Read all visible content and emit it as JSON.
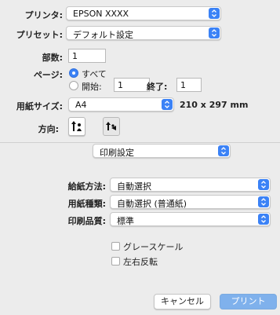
{
  "printer": {
    "label": "プリンタ:",
    "value": "EPSON XXXX"
  },
  "preset": {
    "label": "プリセット:",
    "value": "デフォルト設定"
  },
  "copies": {
    "label": "部数:",
    "value": "1"
  },
  "pages": {
    "label": "ページ:",
    "all_label": "すべて",
    "from_label": "開始:",
    "from_value": "1",
    "to_label": "終了:",
    "to_value": "1"
  },
  "paper_size": {
    "label": "用紙サイズ:",
    "value": "A4",
    "dimensions": "210 x 297 mm"
  },
  "orientation": {
    "label": "方向:"
  },
  "section": {
    "value": "印刷設定"
  },
  "paper_source": {
    "label": "給紙方法:",
    "value": "自動選択"
  },
  "media_type": {
    "label": "用紙種類:",
    "value": "自動選択 (普通紙)"
  },
  "print_quality": {
    "label": "印刷品質:",
    "value": "標準"
  },
  "grayscale": {
    "label": "グレースケール"
  },
  "mirror": {
    "label": "左右反転"
  },
  "buttons": {
    "cancel": "キャンセル",
    "print": "プリント"
  },
  "colors": {
    "accent": "#3b82f6",
    "print_button": "#7fb1ec"
  }
}
